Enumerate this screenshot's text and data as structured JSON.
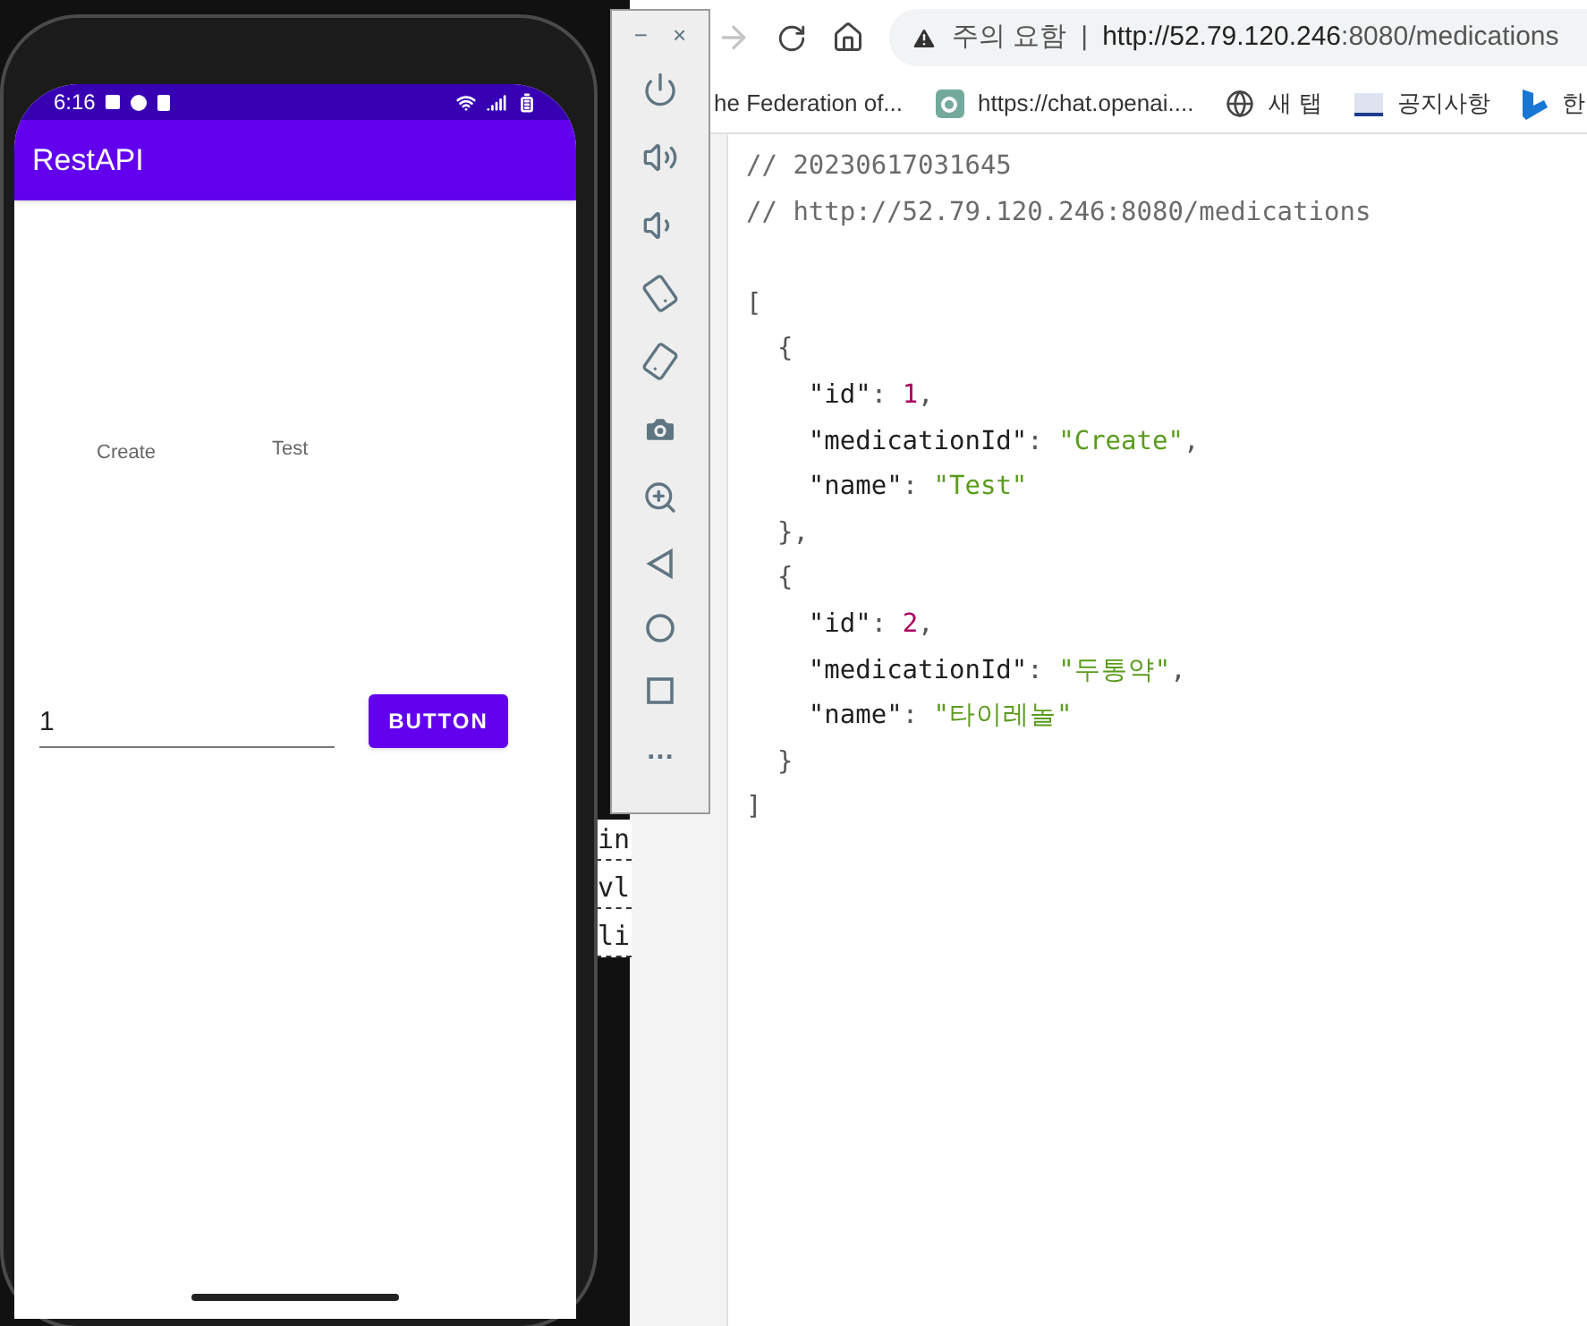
{
  "phone": {
    "status_bar": {
      "time": "6:16"
    },
    "app_bar": {
      "title": "RestAPI"
    },
    "list_row": {
      "medication_id": "Create",
      "name": "Test"
    },
    "input": {
      "value": "1"
    },
    "button": {
      "label": "BUTTON"
    }
  },
  "background_fragments": [
    "in",
    "vl",
    "li"
  ],
  "emulator_toolbar": {
    "minimize": "−",
    "close": "×",
    "more": "…"
  },
  "browser": {
    "forward_disabled": true,
    "address": {
      "warning": "주의 요함",
      "separator": "|",
      "url_host": "http://52.79.120.246",
      "url_rest": ":8080/medications"
    },
    "bookmarks": [
      {
        "label": "he Federation of...",
        "kind": "plain"
      },
      {
        "label": "https://chat.openai....",
        "kind": "chat"
      },
      {
        "label": "새 탭",
        "kind": "globe"
      },
      {
        "label": "공지사항",
        "kind": "ku"
      },
      {
        "label": "한",
        "kind": "blue"
      }
    ],
    "comments": [
      "// 20230617031645",
      "// http://52.79.120.246:8080/medications"
    ],
    "json_lines": [
      [
        {
          "kind": "punct",
          "text": "["
        }
      ],
      [
        {
          "kind": "punct",
          "text": "  {"
        }
      ],
      [
        {
          "kind": "key",
          "text": "    \"id\""
        },
        {
          "kind": "punct",
          "text": ": "
        },
        {
          "kind": "number",
          "text": "1"
        },
        {
          "kind": "punct",
          "text": ","
        }
      ],
      [
        {
          "kind": "key",
          "text": "    \"medicationId\""
        },
        {
          "kind": "punct",
          "text": ": "
        },
        {
          "kind": "string",
          "text": "\"Create\""
        },
        {
          "kind": "punct",
          "text": ","
        }
      ],
      [
        {
          "kind": "key",
          "text": "    \"name\""
        },
        {
          "kind": "punct",
          "text": ": "
        },
        {
          "kind": "string",
          "text": "\"Test\""
        }
      ],
      [
        {
          "kind": "punct",
          "text": "  },"
        }
      ],
      [
        {
          "kind": "punct",
          "text": "  {"
        }
      ],
      [
        {
          "kind": "key",
          "text": "    \"id\""
        },
        {
          "kind": "punct",
          "text": ": "
        },
        {
          "kind": "number",
          "text": "2"
        },
        {
          "kind": "punct",
          "text": ","
        }
      ],
      [
        {
          "kind": "key",
          "text": "    \"medicationId\""
        },
        {
          "kind": "punct",
          "text": ": "
        },
        {
          "kind": "string",
          "text": "\"두통약\""
        },
        {
          "kind": "punct",
          "text": ","
        }
      ],
      [
        {
          "kind": "key",
          "text": "    \"name\""
        },
        {
          "kind": "punct",
          "text": ": "
        },
        {
          "kind": "string",
          "text": "\"타이레놀\""
        }
      ],
      [
        {
          "kind": "punct",
          "text": "  }"
        }
      ],
      [
        {
          "kind": "punct",
          "text": "]"
        }
      ]
    ]
  }
}
